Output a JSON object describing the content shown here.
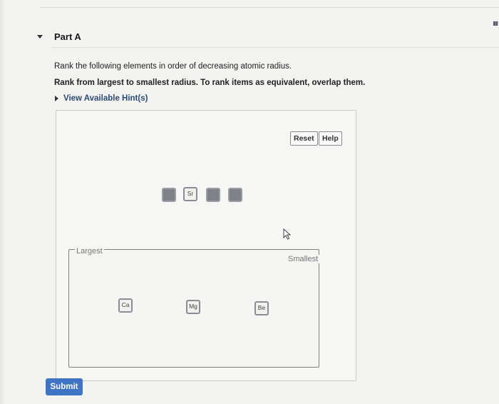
{
  "part": {
    "title": "Part A"
  },
  "instructions": {
    "line1": "Rank the following elements in order of decreasing atomic radius.",
    "line2": "Rank from largest to smallest radius. To rank items as equivalent, overlap them."
  },
  "hints": {
    "label": "View Available Hint(s)"
  },
  "controls": {
    "reset_label": "Reset",
    "help_label": "Help"
  },
  "pool": {
    "tiles": [
      "",
      "Sr",
      "",
      ""
    ]
  },
  "ranking": {
    "largest_label": "Largest",
    "smallest_label": "Smallest",
    "tiles": [
      "Ca",
      "Mg",
      "Be"
    ]
  },
  "submit": {
    "label": "Submit"
  },
  "colors": {
    "submit_bg": "#3f74c4",
    "tile_dark": "#7e8288"
  }
}
